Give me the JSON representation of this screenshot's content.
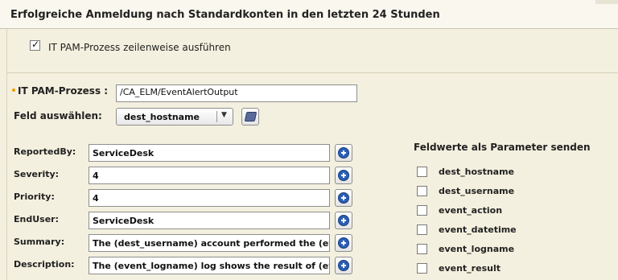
{
  "window": {
    "title": "Erfolgreiche Anmeldung nach Standardkonten in den letzten 24 Stunden"
  },
  "options": {
    "row_mode_checked": true,
    "row_mode_label": "IT PAM-Prozess zeilenweise ausführen"
  },
  "process": {
    "label": "IT PAM-Prozess :",
    "value": "/CA_ELM/EventAlertOutput"
  },
  "field_select": {
    "label": "Feld auswählen:",
    "selected": "dest_hostname"
  },
  "parameters": [
    {
      "name": "ReportedBy:",
      "value": "ServiceDesk"
    },
    {
      "name": "Severity:",
      "value": "4"
    },
    {
      "name": "Priority:",
      "value": "4"
    },
    {
      "name": "EndUser:",
      "value": "ServiceDesk"
    },
    {
      "name": "Summary:",
      "value": "The  (dest_username) account performed the (event_"
    },
    {
      "name": "Description:",
      "value": "The (event_logname) log shows the result of (event_"
    }
  ],
  "send_fields": {
    "title": "Feldwerte als Parameter senden",
    "items": [
      {
        "label": "dest_hostname",
        "checked": false
      },
      {
        "label": "dest_username",
        "checked": false
      },
      {
        "label": "event_action",
        "checked": false
      },
      {
        "label": "event_datetime",
        "checked": false
      },
      {
        "label": "event_logname",
        "checked": false
      },
      {
        "label": "event_result",
        "checked": false
      }
    ]
  }
}
